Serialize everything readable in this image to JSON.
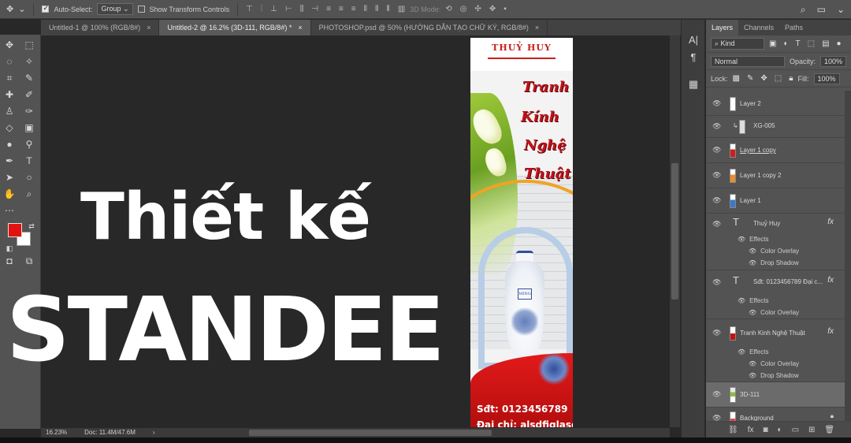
{
  "options_bar": {
    "auto_select_label": "Auto-Select:",
    "auto_select_value": "Group",
    "show_transform_label": "Show Transform Controls",
    "mode_3d_label": "3D Mode:"
  },
  "tabs": [
    {
      "label": "Untitled-1 @ 100% (RGB/8#)",
      "close": "×"
    },
    {
      "label": "Untitled-2 @ 16.2% (3D-111, RGB/8#) *",
      "close": "×"
    },
    {
      "label": "PHOTOSHOP.psd @ 50% (HƯỚNG DẪN TẠO CHỮ KÝ, RGB/8#)",
      "close": "×"
    }
  ],
  "overlay": {
    "line1": "Thiết kế",
    "line2": "STANDEE"
  },
  "standee": {
    "name": "THUỶ HUY",
    "script": [
      "Tranh",
      "Kính",
      "Nghệ",
      "Thuật"
    ],
    "vase_label": "MING",
    "phone": "Sđt: 0123456789",
    "address": "Đại chỉ: alsdfiglasg"
  },
  "status_bar": {
    "zoom": "16.23%",
    "doc": "Doc: 11.4M/47.6M",
    "arrow": "›"
  },
  "colors": {
    "foreground": "#e3110f",
    "background": "#ffffff"
  },
  "layers_panel": {
    "tabs": [
      "Layers",
      "Channels",
      "Paths"
    ],
    "kind_label": "Kind",
    "blend_mode": "Normal",
    "opacity_label": "Opacity:",
    "opacity_value": "100%",
    "lock_label": "Lock:",
    "fill_label": "Fill:",
    "fill_value": "100%",
    "layers": [
      {
        "name": "Layer 2"
      },
      {
        "name": "XG-005"
      },
      {
        "name": "Layer 1 copy"
      },
      {
        "name": "Layer 1 copy 2"
      },
      {
        "name": "Layer 1"
      },
      {
        "name": "Thuỷ Huy",
        "fx": "fx",
        "effects_label": "Effects",
        "effects": [
          "Color Overlay",
          "Drop Shadow"
        ]
      },
      {
        "name": "Sđt: 0123456789 Đại c...",
        "fx": "fx",
        "effects_label": "Effects",
        "effects": [
          "Color Overlay"
        ]
      },
      {
        "name": "Tranh Kinh Nghệ Thuật",
        "fx": "fx",
        "effects_label": "Effects",
        "effects": [
          "Color Overlay",
          "Drop Shadow"
        ]
      },
      {
        "name": "3D-111"
      },
      {
        "name": "Background"
      }
    ]
  },
  "icons": {
    "move": "move-icon",
    "marquee": "marquee-icon",
    "lasso": "lasso-icon",
    "wand": "magic-wand-icon",
    "crop": "crop-icon",
    "eyedropper": "eyedropper-icon",
    "heal": "healing-icon",
    "brush": "brush-icon",
    "stamp": "stamp-icon",
    "history": "history-brush-icon",
    "eraser": "eraser-icon",
    "gradient": "gradient-icon",
    "blur": "blur-icon",
    "dodge": "dodge-icon",
    "pen": "pen-icon",
    "type": "type-icon",
    "select": "path-select-icon",
    "shape": "ellipse-icon",
    "hand": "hand-icon",
    "zoom": "zoom-icon"
  }
}
